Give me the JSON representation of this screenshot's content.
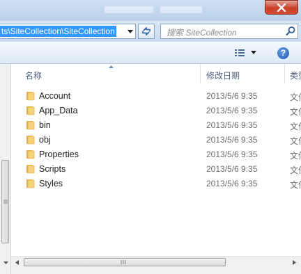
{
  "address": {
    "path": "ts\\SiteCollection\\SiteCollection"
  },
  "search": {
    "placeholder": "搜索 SiteCollection"
  },
  "columns": {
    "name": "名称",
    "date_modified": "修改日期",
    "type": "类型"
  },
  "files": [
    {
      "name": "Account",
      "date": "2013/5/6 9:35",
      "type": "文件夹"
    },
    {
      "name": "App_Data",
      "date": "2013/5/6 9:35",
      "type": "文件夹"
    },
    {
      "name": "bin",
      "date": "2013/5/6 9:35",
      "type": "文件夹"
    },
    {
      "name": "obj",
      "date": "2013/5/6 9:35",
      "type": "文件夹"
    },
    {
      "name": "Properties",
      "date": "2013/5/6 9:35",
      "type": "文件夹"
    },
    {
      "name": "Scripts",
      "date": "2013/5/6 9:35",
      "type": "文件夹"
    },
    {
      "name": "Styles",
      "date": "2013/5/6 9:35",
      "type": "文件夹"
    }
  ],
  "toolbar": {
    "help_label": "?"
  },
  "icons": {
    "folder": "folder-icon",
    "search": "search-icon",
    "refresh": "refresh-icon",
    "views": "view-options-icon",
    "help": "help-icon",
    "close": "close-icon"
  },
  "colors": {
    "selection": "#3399ff",
    "folder": "#f2c35a",
    "close_button": "#c7402a"
  }
}
